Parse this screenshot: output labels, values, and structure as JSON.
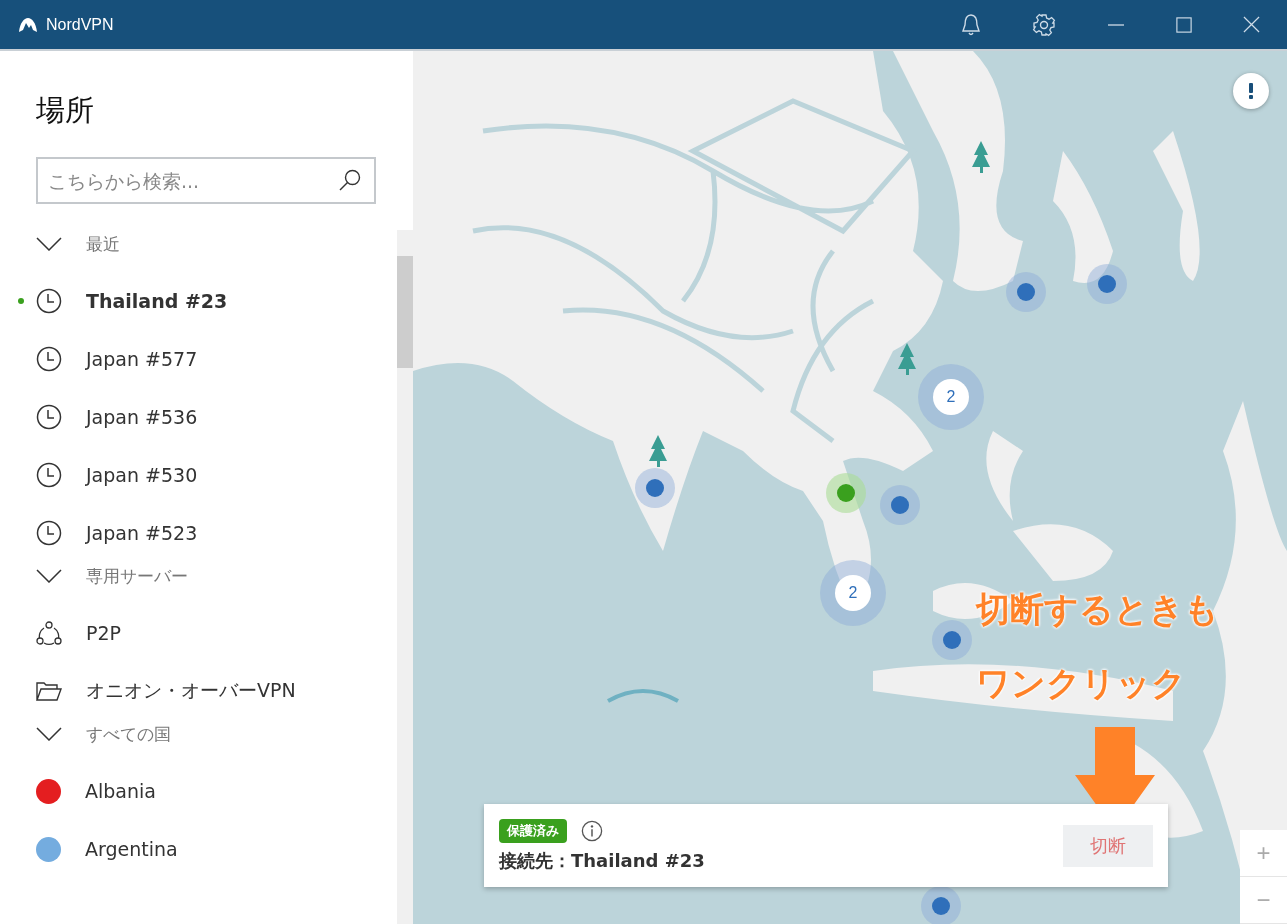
{
  "window": {
    "title": "NordVPN"
  },
  "sidebar": {
    "heading": "場所",
    "search": {
      "placeholder": "こちらから検索..."
    },
    "items": [
      {
        "kind": "section",
        "label": "最近",
        "expanded": true
      },
      {
        "kind": "recent",
        "label": "Thailand #23",
        "selected": true
      },
      {
        "kind": "recent",
        "label": "Japan #577",
        "selected": false
      },
      {
        "kind": "recent",
        "label": "Japan #536",
        "selected": false
      },
      {
        "kind": "recent",
        "label": "Japan #530",
        "selected": false
      },
      {
        "kind": "recent",
        "label": "Japan #523",
        "selected": false
      },
      {
        "kind": "section",
        "label": "専用サーバー",
        "expanded": true
      },
      {
        "kind": "p2p",
        "label": "P2P",
        "selected": false
      },
      {
        "kind": "onion",
        "label": "オニオン・オーバーVPN",
        "selected": false
      },
      {
        "kind": "section",
        "label": "すべての国",
        "expanded": true
      },
      {
        "kind": "flag",
        "label": "Albania",
        "color": "#e41e20",
        "selected": false
      },
      {
        "kind": "flag",
        "label": "Argentina",
        "color": "#74acdf",
        "selected": false
      }
    ]
  },
  "map": {
    "markers": [
      {
        "kind": "server",
        "connected": false
      },
      {
        "kind": "server",
        "connected": false
      },
      {
        "kind": "cluster",
        "count": "2"
      },
      {
        "kind": "server",
        "connected": false
      },
      {
        "kind": "server",
        "connected": true
      },
      {
        "kind": "server",
        "connected": false
      },
      {
        "kind": "cluster",
        "count": "2"
      },
      {
        "kind": "server",
        "connected": false
      },
      {
        "kind": "server",
        "connected": false
      }
    ],
    "zoom_controls": [
      "+",
      "−"
    ],
    "connection": {
      "status": "保護済み",
      "label": "接続先：Thailand #23",
      "button": "切断"
    },
    "annotation": {
      "lines": [
        "切断するときも",
        "ワンクリック"
      ]
    }
  }
}
